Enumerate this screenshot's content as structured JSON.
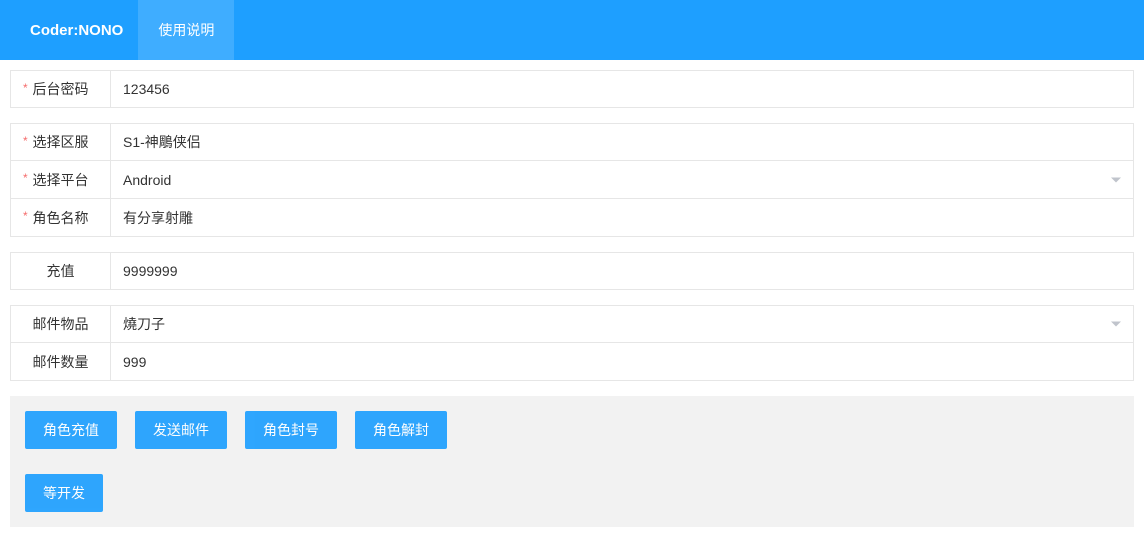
{
  "header": {
    "brand": "Coder:NONO",
    "tab_help": "使用说明"
  },
  "form": {
    "password": {
      "label": "后台密码",
      "value": "123456",
      "required": true
    },
    "server": {
      "label": "选择区服",
      "value": "S1-神鵰侠侣",
      "required": true
    },
    "platform": {
      "label": "选择平台",
      "value": "Android",
      "required": true,
      "dropdown": true
    },
    "role": {
      "label": "角色名称",
      "value": "有分享射雕",
      "required": true
    },
    "recharge": {
      "label": "充值",
      "value": "9999999",
      "required": false
    },
    "mailitem": {
      "label": "邮件物品",
      "value": "燒刀子",
      "required": false,
      "dropdown": true
    },
    "mailqty": {
      "label": "邮件数量",
      "value": "999",
      "required": false
    }
  },
  "buttons": {
    "recharge": "角色充值",
    "sendmail": "发送邮件",
    "ban": "角色封号",
    "unban": "角色解封",
    "pending": "等开发"
  }
}
